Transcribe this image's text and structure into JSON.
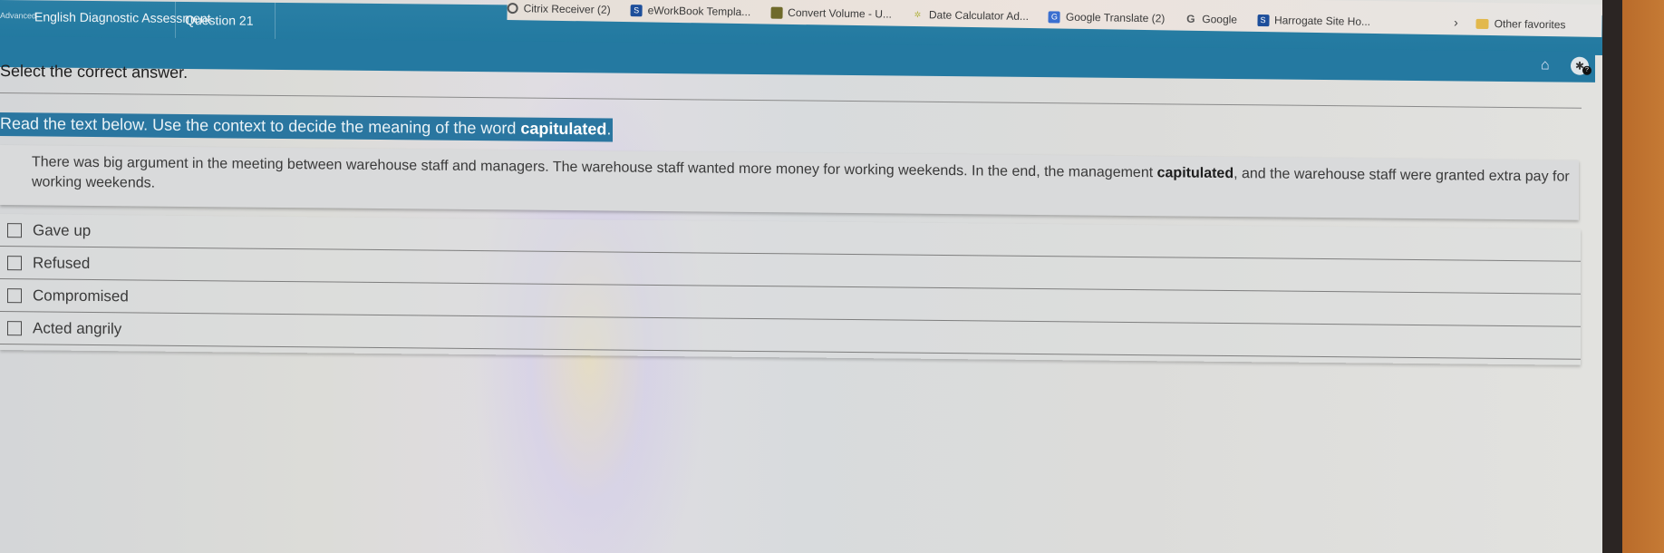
{
  "header": {
    "level_label": "Advanced",
    "breadcrumbs": [
      {
        "label": "English Diagnostic Assessment"
      },
      {
        "label": "Question 21"
      }
    ]
  },
  "bookmarks_bar": {
    "items": [
      {
        "label": "Citrix Receiver (2)",
        "icon": "citrix-icon"
      },
      {
        "label": "eWorkBook Templa...",
        "icon": "sharepoint-icon"
      },
      {
        "label": "Convert Volume - U...",
        "icon": "convert-icon"
      },
      {
        "label": "Date Calculator Ad...",
        "icon": "date-calculator-icon"
      },
      {
        "label": "Google Translate (2)",
        "icon": "google-translate-icon"
      },
      {
        "label": "Google",
        "icon": "google-icon"
      },
      {
        "label": "Harrogate Site Ho...",
        "icon": "sharepoint-icon"
      }
    ],
    "more_glyph": "›",
    "other_favorites": "Other favorites"
  },
  "toolbar": {
    "home_icon": "⌂",
    "accessibility_icon": "✱",
    "help_badge": "?"
  },
  "question": {
    "instruction": "Select the correct answer.",
    "prompt_prefix": "Read the text below. Use the context to decide the meaning of the word ",
    "prompt_word": "capitulated",
    "prompt_suffix": ".",
    "passage_part1": "There was big argument in the meeting between warehouse staff and managers. The warehouse staff wanted more money for working weekends. In the end, the management ",
    "passage_word": "capitulated",
    "passage_part2": ", and the warehouse staff were granted extra pay for working weekends.",
    "options": [
      {
        "label": "Gave up",
        "checked": false
      },
      {
        "label": "Refused",
        "checked": false
      },
      {
        "label": "Compromised",
        "checked": false
      },
      {
        "label": "Acted angrily",
        "checked": false
      }
    ]
  },
  "colors": {
    "header_blue": "#2479a1",
    "prompt_blue": "#2a76a0",
    "page_bg": "#dcdcda"
  }
}
